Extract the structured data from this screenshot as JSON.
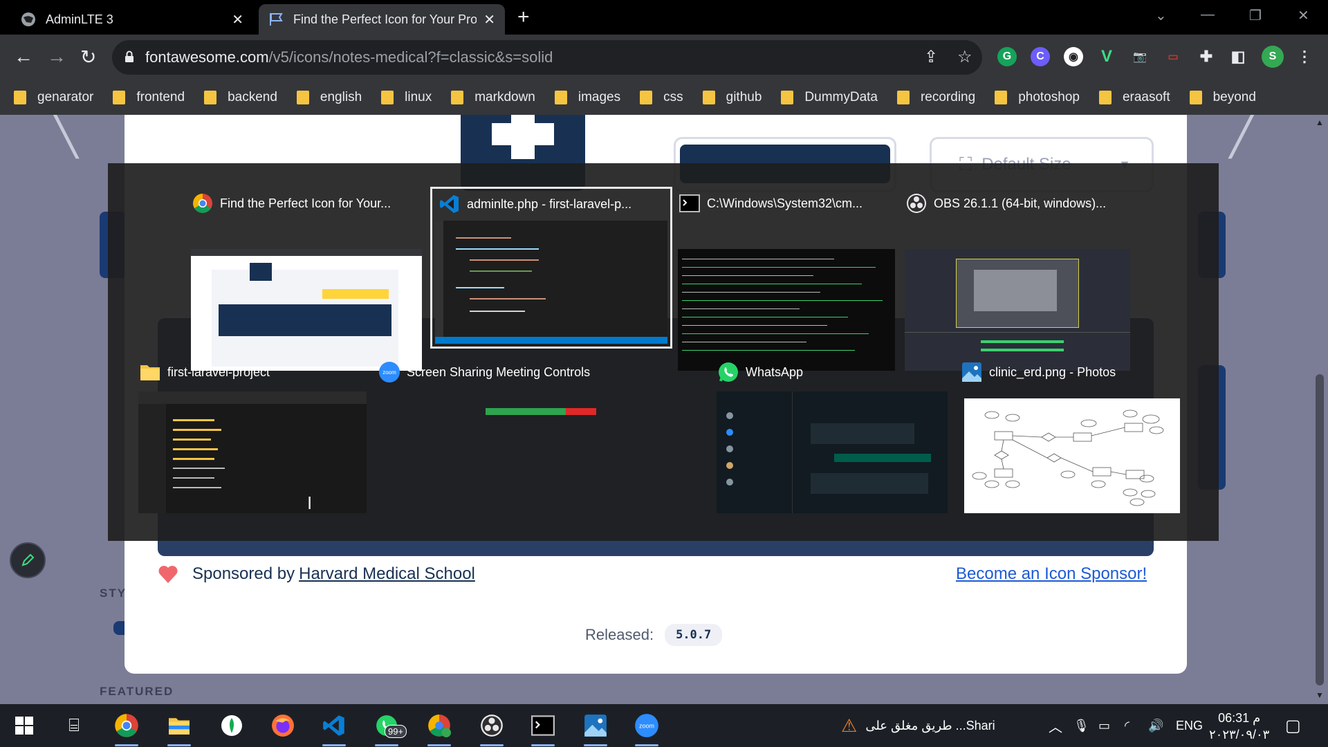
{
  "browser": {
    "tabs": [
      {
        "title": "AdminLTE 3"
      },
      {
        "title": "Find the Perfect Icon for Your Pro"
      }
    ],
    "url_host": "fontawesome.com",
    "url_path": "/v5/icons/notes-medical?f=classic&s=solid",
    "profile_initial": "S",
    "bookmarks": [
      "genarator",
      "frontend",
      "backend",
      "english",
      "linux",
      "markdown",
      "images",
      "css",
      "github",
      "DummyData",
      "recording",
      "photoshop",
      "eraasoft",
      "beyond"
    ]
  },
  "page": {
    "size_select": "Default Size",
    "sponsor_prefix": "Sponsored by",
    "sponsor_name": "Harvard Medical School",
    "become_sponsor": "Become an Icon Sponsor!",
    "released_label": "Released:",
    "released_version": "5.0.7",
    "style_label": "STY",
    "featured_label": "FEATURED"
  },
  "switcher": {
    "windows": [
      {
        "title": "Find the Perfect Icon for Your...",
        "icon": "chrome-icon"
      },
      {
        "title": "adminlte.php - first-laravel-p...",
        "icon": "vscode-icon"
      },
      {
        "title": "C:\\Windows\\System32\\cm...",
        "icon": "cmd-icon"
      },
      {
        "title": "OBS 26.1.1 (64-bit, windows)...",
        "icon": "obs-icon"
      },
      {
        "title": "first-laravel-project",
        "icon": "folder-icon"
      },
      {
        "title": "Screen Sharing Meeting Controls",
        "icon": "zoom-icon"
      },
      {
        "title": "WhatsApp",
        "icon": "whatsapp-icon"
      },
      {
        "title": "clinic_erd.png - Photos",
        "icon": "photos-icon"
      }
    ]
  },
  "taskbar": {
    "whatsapp_badge": "99+",
    "notification_text": "طريق مغلق على ...Shari",
    "language": "ENG",
    "time": "06:31 م",
    "date": "٢٠٢٣/٠٩/٠٣"
  },
  "colors": {
    "chrome_dark": "#35363a",
    "fa_navy": "#183153",
    "sponsor_link": "#1e5ad4",
    "heart": "#f0676b"
  }
}
